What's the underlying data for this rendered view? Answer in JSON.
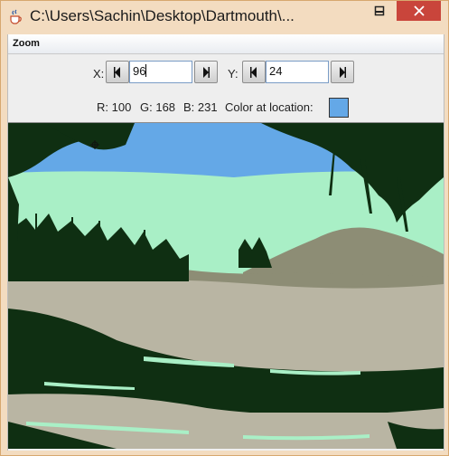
{
  "window": {
    "title": "C:\\Users\\Sachin\\Desktop\\Dartmouth\\..."
  },
  "menu": {
    "zoom_label": "Zoom"
  },
  "controls": {
    "x_label": "X:",
    "x_value": "96",
    "y_label": "Y:",
    "y_value": "24",
    "r_label": "R: 100",
    "g_label": "G: 168",
    "b_label": "B: 231",
    "color_label": "Color at location:",
    "swatch_color": "#64a8e7"
  },
  "icons": {
    "app": "java-cup-icon",
    "minimize": "minimize-icon",
    "maximize": "maximize-icon",
    "close": "close-icon",
    "left": "left-arrow-icon",
    "right": "right-arrow-icon",
    "cursor": "crosshair-icon"
  },
  "palette": {
    "sky": "#64a8e7",
    "haze": "#a9efc6",
    "gray": "#8d8d75",
    "sand": "#b9b5a3",
    "dark": "#0f2f12",
    "close": "#c9453b"
  }
}
